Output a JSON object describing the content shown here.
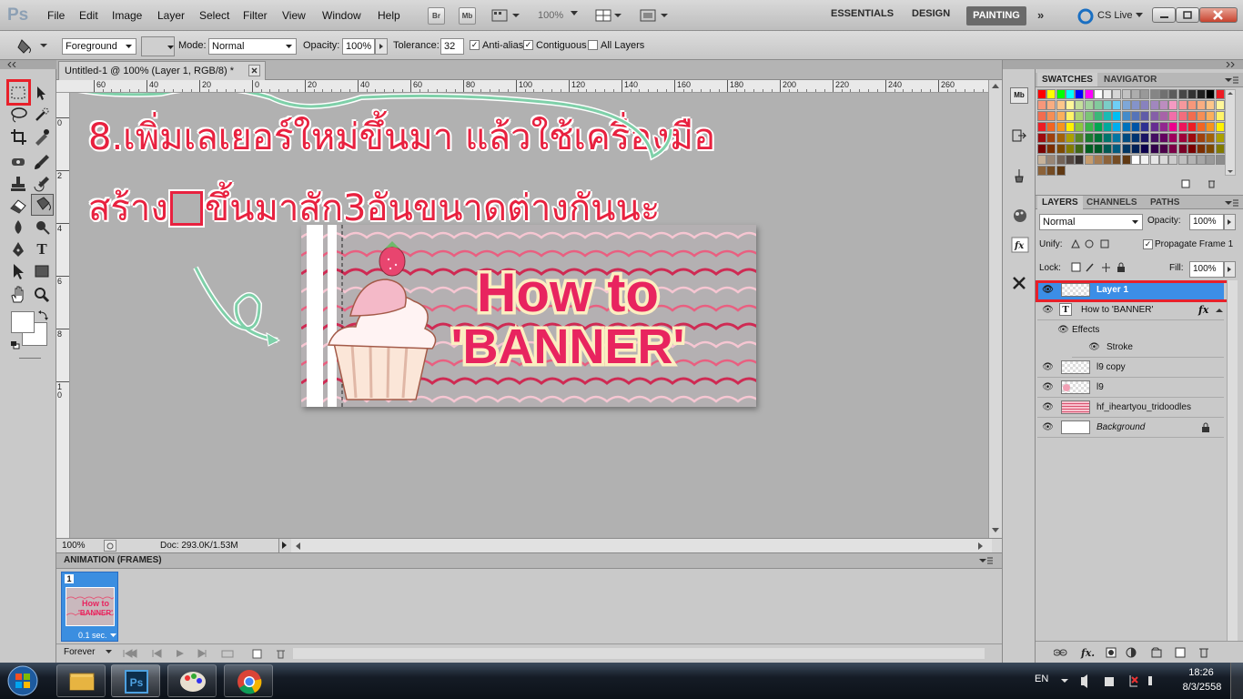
{
  "app": {
    "logo": "Ps",
    "menu": [
      "File",
      "Edit",
      "Image",
      "Layer",
      "Select",
      "Filter",
      "View",
      "Window",
      "Help"
    ],
    "bridge_btn": "Br",
    "minibridge_btn": "Mb",
    "zoom": "100%",
    "workspaces": [
      "ESSENTIALS",
      "DESIGN",
      "PAINTING"
    ],
    "active_workspace": "PAINTING",
    "cs_live": "CS Live"
  },
  "options": {
    "fill_source": "Foreground",
    "mode_label": "Mode:",
    "mode": "Normal",
    "opacity_label": "Opacity:",
    "opacity": "100%",
    "tolerance_label": "Tolerance:",
    "tolerance": "32",
    "antialias": "Anti-alias",
    "contiguous": "Contiguous",
    "all_layers": "All Layers"
  },
  "document": {
    "tab_title": "Untitled-1 @ 100% (Layer 1, RGB/8) *",
    "ruler_top": [
      "60",
      "40",
      "20",
      "0",
      "20",
      "40",
      "60",
      "80",
      "100",
      "120",
      "140",
      "160",
      "180",
      "200",
      "220",
      "240",
      "260"
    ],
    "ruler_left": [
      "0",
      "2",
      "4",
      "6",
      "8",
      "10"
    ],
    "zoom": "100%",
    "doc_info": "Doc: 293.0K/1.53M",
    "annotation_line1": "8.เพิ่มเลเยอร์ใหม่ขึ้นมา แล้วใช้เครื่องมือ",
    "annotation_line2a": "สร้าง",
    "annotation_line2b": "ขึ้นมาสัก3อันขนาดต่างกันนะ",
    "banner_line1": "How to",
    "banner_line2": "'BANNER'"
  },
  "animation": {
    "tab": "ANIMATION (FRAMES)",
    "frame_number": "1",
    "frame_time": "0.1 sec.",
    "loop": "Forever",
    "thumb_line1": "How to",
    "thumb_line2": "'BANNER'"
  },
  "panels": {
    "swatch_tabs": [
      "SWATCHES",
      "NAVIGATOR"
    ],
    "layer_tabs": [
      "LAYERS",
      "CHANNELS",
      "PATHS"
    ],
    "blend_mode": "Normal",
    "opacity_label": "Opacity:",
    "opacity": "100%",
    "unify_label": "Unify:",
    "propagate": "Propagate Frame 1",
    "lock_label": "Lock:",
    "fill_label": "Fill:",
    "fill": "100%",
    "layers": [
      {
        "name": "Layer 1",
        "selected": true
      },
      {
        "name": "How to  'BANNER'",
        "type": "text"
      },
      {
        "name": "Effects",
        "type": "effects"
      },
      {
        "name": "Stroke",
        "type": "effect"
      },
      {
        "name": "l9 copy"
      },
      {
        "name": "l9"
      },
      {
        "name": "hf_iheartyou_tridoodles"
      },
      {
        "name": "Background",
        "locked": true
      }
    ]
  },
  "taskbar": {
    "lang": "EN",
    "time": "18:26",
    "date": "8/3/2558"
  },
  "colors": {
    "annotation": "#e8213f",
    "highlight": "#e8202a",
    "selected_layer": "#3c8ee6",
    "banner_text": "#e8245f",
    "banner_outline": "#fbeec1",
    "arrow": "#7fd0a9"
  }
}
